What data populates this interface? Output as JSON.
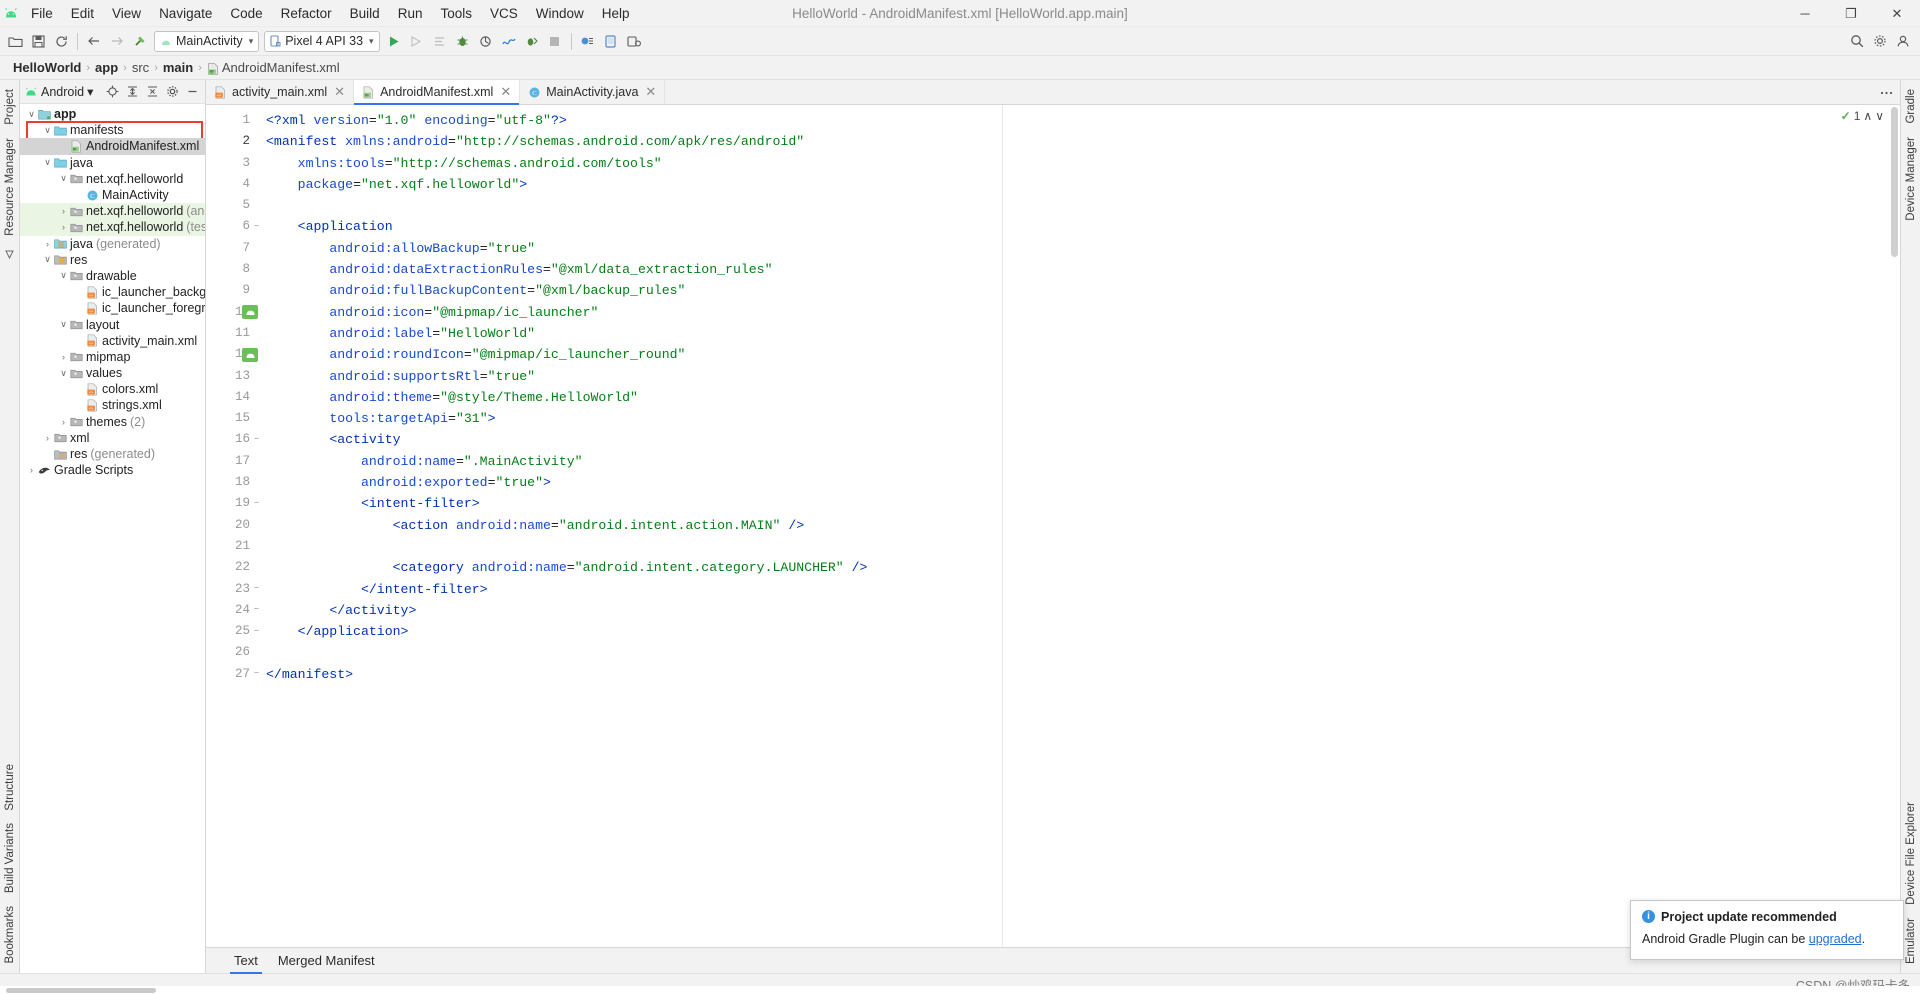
{
  "window": {
    "title": "HelloWorld - AndroidManifest.xml [HelloWorld.app.main]",
    "minimize": "─",
    "maximize": "❐",
    "close": "✕"
  },
  "menu": {
    "items": [
      {
        "label": "File"
      },
      {
        "label": "Edit"
      },
      {
        "label": "View"
      },
      {
        "label": "Navigate"
      },
      {
        "label": "Code"
      },
      {
        "label": "Refactor"
      },
      {
        "label": "Build"
      },
      {
        "label": "Run"
      },
      {
        "label": "Tools"
      },
      {
        "label": "VCS"
      },
      {
        "label": "Window"
      },
      {
        "label": "Help"
      }
    ]
  },
  "toolbar": {
    "run_config": "MainActivity",
    "device": "Pixel 4 API 33"
  },
  "breadcrumb": {
    "project": "HelloWorld",
    "module": "app",
    "src": "src",
    "main": "main",
    "file": "AndroidManifest.xml",
    "separator": "›"
  },
  "left_tool_window_tabs": [
    {
      "label": "Project"
    },
    {
      "label": "Resource Manager"
    },
    {
      "label": "Structure"
    },
    {
      "label": "Build Variants"
    },
    {
      "label": "Bookmarks"
    }
  ],
  "right_tool_window_tabs": [
    {
      "label": "Gradle"
    },
    {
      "label": "Device Manager"
    },
    {
      "label": "Device File Explorer"
    },
    {
      "label": "Emulator"
    }
  ],
  "project_panel": {
    "view_selector": "Android",
    "tree": [
      {
        "indent": 0,
        "arrow": "v",
        "icon": "module-folder",
        "label": "app",
        "bold": true,
        "dim": "",
        "state": "normal"
      },
      {
        "indent": 1,
        "arrow": "v",
        "icon": "folder-blue",
        "label": "manifests",
        "bold": false,
        "dim": "",
        "state": "normal"
      },
      {
        "indent": 2,
        "arrow": "",
        "icon": "manifest-file",
        "label": "AndroidManifest.xml",
        "bold": false,
        "dim": "",
        "state": "selected"
      },
      {
        "indent": 1,
        "arrow": "v",
        "icon": "folder-blue",
        "label": "java",
        "bold": false,
        "dim": "",
        "state": "normal"
      },
      {
        "indent": 2,
        "arrow": "v",
        "icon": "package",
        "label": "net.xqf.helloworld",
        "bold": false,
        "dim": "",
        "state": "normal"
      },
      {
        "indent": 3,
        "arrow": "",
        "icon": "class",
        "label": "MainActivity",
        "bold": false,
        "dim": "",
        "state": "normal"
      },
      {
        "indent": 2,
        "arrow": ">",
        "icon": "package",
        "label": "net.xqf.helloworld",
        "bold": false,
        "dim": "(androidTest)",
        "state": "green"
      },
      {
        "indent": 2,
        "arrow": ">",
        "icon": "package",
        "label": "net.xqf.helloworld",
        "bold": false,
        "dim": "(test)",
        "state": "green"
      },
      {
        "indent": 1,
        "arrow": ">",
        "icon": "folder-gen",
        "label": "java",
        "bold": false,
        "dim": "(generated)",
        "state": "normal"
      },
      {
        "indent": 1,
        "arrow": "v",
        "icon": "res-folder",
        "label": "res",
        "bold": false,
        "dim": "",
        "state": "normal"
      },
      {
        "indent": 2,
        "arrow": "v",
        "icon": "package",
        "label": "drawable",
        "bold": false,
        "dim": "",
        "state": "normal"
      },
      {
        "indent": 3,
        "arrow": "",
        "icon": "xml-file",
        "label": "ic_launcher_background",
        "bold": false,
        "dim": "",
        "state": "normal"
      },
      {
        "indent": 3,
        "arrow": "",
        "icon": "xml-file",
        "label": "ic_launcher_foreground",
        "bold": false,
        "dim": "",
        "state": "normal"
      },
      {
        "indent": 2,
        "arrow": "v",
        "icon": "package",
        "label": "layout",
        "bold": false,
        "dim": "",
        "state": "normal"
      },
      {
        "indent": 3,
        "arrow": "",
        "icon": "xml-file",
        "label": "activity_main.xml",
        "bold": false,
        "dim": "",
        "state": "normal"
      },
      {
        "indent": 2,
        "arrow": ">",
        "icon": "package",
        "label": "mipmap",
        "bold": false,
        "dim": "",
        "state": "normal"
      },
      {
        "indent": 2,
        "arrow": "v",
        "icon": "package",
        "label": "values",
        "bold": false,
        "dim": "",
        "state": "normal"
      },
      {
        "indent": 3,
        "arrow": "",
        "icon": "xml-file",
        "label": "colors.xml",
        "bold": false,
        "dim": "",
        "state": "normal"
      },
      {
        "indent": 3,
        "arrow": "",
        "icon": "xml-file",
        "label": "strings.xml",
        "bold": false,
        "dim": "",
        "state": "normal"
      },
      {
        "indent": 2,
        "arrow": ">",
        "icon": "package",
        "label": "themes",
        "bold": false,
        "dim": "(2)",
        "state": "normal"
      },
      {
        "indent": 1,
        "arrow": ">",
        "icon": "package",
        "label": "xml",
        "bold": false,
        "dim": "",
        "state": "normal"
      },
      {
        "indent": 1,
        "arrow": "",
        "icon": "res-folder",
        "label": "res",
        "bold": false,
        "dim": "(generated)",
        "state": "normal"
      },
      {
        "indent": 0,
        "arrow": ">",
        "icon": "gradle",
        "label": "Gradle Scripts",
        "bold": false,
        "dim": "",
        "state": "normal"
      }
    ]
  },
  "editor": {
    "tabs": [
      {
        "label": "activity_main.xml",
        "icon": "xml-file",
        "active": false
      },
      {
        "label": "AndroidManifest.xml",
        "icon": "manifest-file",
        "active": true
      },
      {
        "label": "MainActivity.java",
        "icon": "class",
        "active": false
      }
    ],
    "inspection": {
      "check": "✓",
      "count": "1",
      "up": "∧",
      "down": "∨"
    },
    "bottom_tabs": [
      {
        "label": "Text",
        "active": true
      },
      {
        "label": "Merged Manifest",
        "active": false
      }
    ],
    "lines": [
      {
        "n": "1",
        "fold": "",
        "marker": false,
        "tokens": [
          {
            "t": "<?xml ",
            "c": "tag"
          },
          {
            "t": "version",
            "c": "attr"
          },
          {
            "t": "=",
            "c": "punct"
          },
          {
            "t": "\"1.0\"",
            "c": "val"
          },
          {
            "t": " ",
            "c": "punct"
          },
          {
            "t": "encoding",
            "c": "attr"
          },
          {
            "t": "=",
            "c": "punct"
          },
          {
            "t": "\"utf-8\"",
            "c": "val"
          },
          {
            "t": "?>",
            "c": "tag"
          }
        ]
      },
      {
        "n": "2",
        "fold": "",
        "marker": false,
        "tokens": [
          {
            "t": "<manifest ",
            "c": "tag"
          },
          {
            "t": "xmlns:android",
            "c": "attr"
          },
          {
            "t": "=",
            "c": "punct"
          },
          {
            "t": "\"http://schemas.android.com/apk/res/android\"",
            "c": "val"
          }
        ]
      },
      {
        "n": "3",
        "fold": "",
        "marker": false,
        "tokens": [
          {
            "t": "    ",
            "c": "punct"
          },
          {
            "t": "xmlns:tools",
            "c": "attr"
          },
          {
            "t": "=",
            "c": "punct"
          },
          {
            "t": "\"http://schemas.android.com/tools\"",
            "c": "val"
          }
        ]
      },
      {
        "n": "4",
        "fold": "",
        "marker": false,
        "tokens": [
          {
            "t": "    ",
            "c": "punct"
          },
          {
            "t": "package",
            "c": "attr"
          },
          {
            "t": "=",
            "c": "punct"
          },
          {
            "t": "\"net.xqf.helloworld\"",
            "c": "val"
          },
          {
            "t": ">",
            "c": "tag"
          }
        ]
      },
      {
        "n": "5",
        "fold": "",
        "marker": false,
        "tokens": []
      },
      {
        "n": "6",
        "fold": "-",
        "marker": false,
        "tokens": [
          {
            "t": "    ",
            "c": "punct"
          },
          {
            "t": "<application",
            "c": "tag"
          }
        ]
      },
      {
        "n": "7",
        "fold": "",
        "marker": false,
        "tokens": [
          {
            "t": "        ",
            "c": "punct"
          },
          {
            "t": "android:allowBackup",
            "c": "attr"
          },
          {
            "t": "=",
            "c": "punct"
          },
          {
            "t": "\"true\"",
            "c": "val"
          }
        ]
      },
      {
        "n": "8",
        "fold": "",
        "marker": false,
        "tokens": [
          {
            "t": "        ",
            "c": "punct"
          },
          {
            "t": "android:dataExtractionRules",
            "c": "attr"
          },
          {
            "t": "=",
            "c": "punct"
          },
          {
            "t": "\"@xml/data_extraction_rules\"",
            "c": "val"
          }
        ]
      },
      {
        "n": "9",
        "fold": "",
        "marker": false,
        "tokens": [
          {
            "t": "        ",
            "c": "punct"
          },
          {
            "t": "android:fullBackupContent",
            "c": "attr"
          },
          {
            "t": "=",
            "c": "punct"
          },
          {
            "t": "\"@xml/backup_rules\"",
            "c": "val"
          }
        ]
      },
      {
        "n": "10",
        "fold": "",
        "marker": true,
        "tokens": [
          {
            "t": "        ",
            "c": "punct"
          },
          {
            "t": "android:icon",
            "c": "attr"
          },
          {
            "t": "=",
            "c": "punct"
          },
          {
            "t": "\"@mipmap/ic_launcher\"",
            "c": "val"
          }
        ]
      },
      {
        "n": "11",
        "fold": "",
        "marker": false,
        "tokens": [
          {
            "t": "        ",
            "c": "punct"
          },
          {
            "t": "android:label",
            "c": "attr"
          },
          {
            "t": "=",
            "c": "punct"
          },
          {
            "t": "\"HelloWorld\"",
            "c": "val"
          }
        ]
      },
      {
        "n": "12",
        "fold": "",
        "marker": true,
        "tokens": [
          {
            "t": "        ",
            "c": "punct"
          },
          {
            "t": "android:roundIcon",
            "c": "attr"
          },
          {
            "t": "=",
            "c": "punct"
          },
          {
            "t": "\"@mipmap/ic_launcher_round\"",
            "c": "val"
          }
        ]
      },
      {
        "n": "13",
        "fold": "",
        "marker": false,
        "tokens": [
          {
            "t": "        ",
            "c": "punct"
          },
          {
            "t": "android:supportsRtl",
            "c": "attr"
          },
          {
            "t": "=",
            "c": "punct"
          },
          {
            "t": "\"true\"",
            "c": "val"
          }
        ]
      },
      {
        "n": "14",
        "fold": "",
        "marker": false,
        "tokens": [
          {
            "t": "        ",
            "c": "punct"
          },
          {
            "t": "android:theme",
            "c": "attr"
          },
          {
            "t": "=",
            "c": "punct"
          },
          {
            "t": "\"@style/Theme.HelloWorld\"",
            "c": "val"
          }
        ]
      },
      {
        "n": "15",
        "fold": "",
        "marker": false,
        "tokens": [
          {
            "t": "        ",
            "c": "punct"
          },
          {
            "t": "tools:targetApi",
            "c": "attr"
          },
          {
            "t": "=",
            "c": "punct"
          },
          {
            "t": "\"31\"",
            "c": "val"
          },
          {
            "t": ">",
            "c": "tag"
          }
        ]
      },
      {
        "n": "16",
        "fold": "-",
        "marker": false,
        "tokens": [
          {
            "t": "        ",
            "c": "punct"
          },
          {
            "t": "<activity",
            "c": "tag"
          }
        ]
      },
      {
        "n": "17",
        "fold": "",
        "marker": false,
        "tokens": [
          {
            "t": "            ",
            "c": "punct"
          },
          {
            "t": "android:name",
            "c": "attr"
          },
          {
            "t": "=",
            "c": "punct"
          },
          {
            "t": "\".MainActivity\"",
            "c": "val"
          }
        ]
      },
      {
        "n": "18",
        "fold": "",
        "marker": false,
        "tokens": [
          {
            "t": "            ",
            "c": "punct"
          },
          {
            "t": "android:exported",
            "c": "attr"
          },
          {
            "t": "=",
            "c": "punct"
          },
          {
            "t": "\"true\"",
            "c": "val"
          },
          {
            "t": ">",
            "c": "tag"
          }
        ]
      },
      {
        "n": "19",
        "fold": "-",
        "marker": false,
        "tokens": [
          {
            "t": "            ",
            "c": "punct"
          },
          {
            "t": "<intent-filter",
            "c": "tag"
          },
          {
            "t": ">",
            "c": "tag"
          }
        ]
      },
      {
        "n": "20",
        "fold": "",
        "marker": false,
        "tokens": [
          {
            "t": "                ",
            "c": "punct"
          },
          {
            "t": "<action ",
            "c": "tag"
          },
          {
            "t": "android:name",
            "c": "attr"
          },
          {
            "t": "=",
            "c": "punct"
          },
          {
            "t": "\"android.intent.action.MAIN\"",
            "c": "val"
          },
          {
            "t": " />",
            "c": "tag"
          }
        ]
      },
      {
        "n": "21",
        "fold": "",
        "marker": false,
        "tokens": []
      },
      {
        "n": "22",
        "fold": "",
        "marker": false,
        "tokens": [
          {
            "t": "                ",
            "c": "punct"
          },
          {
            "t": "<category ",
            "c": "tag"
          },
          {
            "t": "android:name",
            "c": "attr"
          },
          {
            "t": "=",
            "c": "punct"
          },
          {
            "t": "\"android.intent.category.LAUNCHER\"",
            "c": "val"
          },
          {
            "t": " />",
            "c": "tag"
          }
        ]
      },
      {
        "n": "23",
        "fold": "-",
        "marker": false,
        "tokens": [
          {
            "t": "            ",
            "c": "punct"
          },
          {
            "t": "</intent-filter>",
            "c": "tag"
          }
        ]
      },
      {
        "n": "24",
        "fold": "-",
        "marker": false,
        "tokens": [
          {
            "t": "        ",
            "c": "punct"
          },
          {
            "t": "</activity>",
            "c": "tag"
          }
        ]
      },
      {
        "n": "25",
        "fold": "-",
        "marker": false,
        "tokens": [
          {
            "t": "    ",
            "c": "punct"
          },
          {
            "t": "</application>",
            "c": "tag"
          }
        ]
      },
      {
        "n": "26",
        "fold": "",
        "marker": false,
        "tokens": []
      },
      {
        "n": "27",
        "fold": "-",
        "marker": false,
        "tokens": [
          {
            "t": "</manifest>",
            "c": "tag"
          }
        ]
      }
    ]
  },
  "notification": {
    "title": "Project update recommended",
    "body_prefix": "Android Gradle Plugin can be ",
    "link": "upgraded",
    "body_suffix": "."
  },
  "statusbar": {
    "watermark": "CSDN @炒鸡玛卡多"
  },
  "colors": {
    "accent": "#3574f0",
    "highlight_box": "#e8402a",
    "android_green": "#3ddc84",
    "link": "#2470d1",
    "info_blue": "#3592e0",
    "selection_grey": "#d4d4d4",
    "test_green_bg": "#eaf5e4"
  }
}
